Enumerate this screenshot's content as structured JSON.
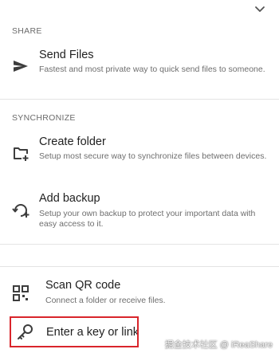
{
  "share": {
    "header": "SHARE",
    "send_files": {
      "title": "Send Files",
      "description": "Fastest and most private way to quick send files to someone.",
      "icon": "send-icon"
    }
  },
  "synchronize": {
    "header": "SYNCHRONIZE",
    "create_folder": {
      "title": "Create folder",
      "description": "Setup most secure way to synchronize files between devices.",
      "icon": "folder-add-icon"
    },
    "add_backup": {
      "title": "Add backup",
      "description": "Setup your own backup to protect your important data with easy access to it.",
      "icon": "backup-add-icon"
    }
  },
  "connect": {
    "scan_qr": {
      "title": "Scan QR code",
      "description": "Connect a folder or receive files.",
      "icon": "qr-code-icon"
    },
    "enter_key": {
      "title": "Enter a key or link",
      "icon": "key-icon"
    }
  },
  "watermark": "掘金技术社区 @ iReaShare",
  "colors": {
    "highlight": "#d9252b",
    "icon": "#3d3d3d"
  }
}
